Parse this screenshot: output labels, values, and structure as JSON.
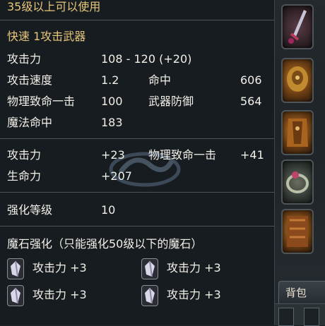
{
  "tooltip": {
    "level_requirement": "35级以上可以使用",
    "weapon_type": "快速 1攻击武器",
    "stats": [
      {
        "label": "攻击力",
        "value": "108 - 120 (+20)"
      },
      {
        "label": "攻击速度",
        "value": "1.2",
        "label2": "命中",
        "value2": "606"
      },
      {
        "label": "物理致命一击",
        "value": "100",
        "label2": "武器防御",
        "value2": "564"
      },
      {
        "label": "魔法命中",
        "value": "183"
      }
    ],
    "bonuses": [
      {
        "label": "攻击力",
        "value": "+23",
        "label2": "物理致命一击",
        "value2": "+41"
      },
      {
        "label": "生命力",
        "value": "+207"
      }
    ],
    "enhance": {
      "label": "强化等级",
      "value": "10"
    },
    "magic_stone": {
      "title": "魔石强化（只能强化50级以下的魔石）",
      "slots": [
        "攻击力 +3",
        "攻击力 +3",
        "攻击力 +3",
        "攻击力 +3"
      ]
    }
  },
  "inventory": {
    "bag_label": "背包",
    "equipment_icons": [
      "sword-icon",
      "shoulder-armor-icon",
      "chest-armor-icon",
      "ring-icon",
      "boots-icon"
    ]
  },
  "colors": {
    "title_gold": "#e7c77a",
    "stat_white": "#f1efe8",
    "tooltip_bg": "#171c20"
  }
}
